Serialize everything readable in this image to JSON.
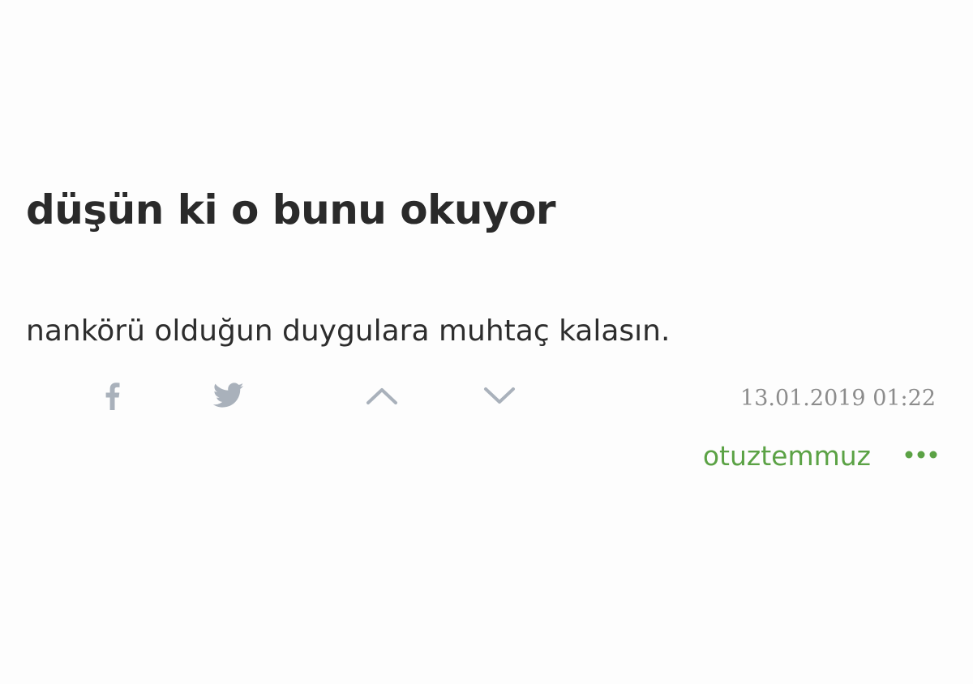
{
  "entry": {
    "title": "düşün ki o bunu okuyor",
    "content": "nankörü olduğun duygulara muhtaç kalasın.",
    "date": "13.01.2019 01:22",
    "author": "otuztemmuz"
  },
  "actions": {
    "facebook_icon": "facebook-icon",
    "twitter_icon": "twitter-icon",
    "upvote_icon": "chevron-up-icon",
    "downvote_icon": "chevron-down-icon",
    "more_icon": "ellipsis-icon"
  },
  "colors": {
    "text": "#2a2a2a",
    "icon": "#a9b1bb",
    "date": "#8c8c8c",
    "author": "#5ba245"
  }
}
